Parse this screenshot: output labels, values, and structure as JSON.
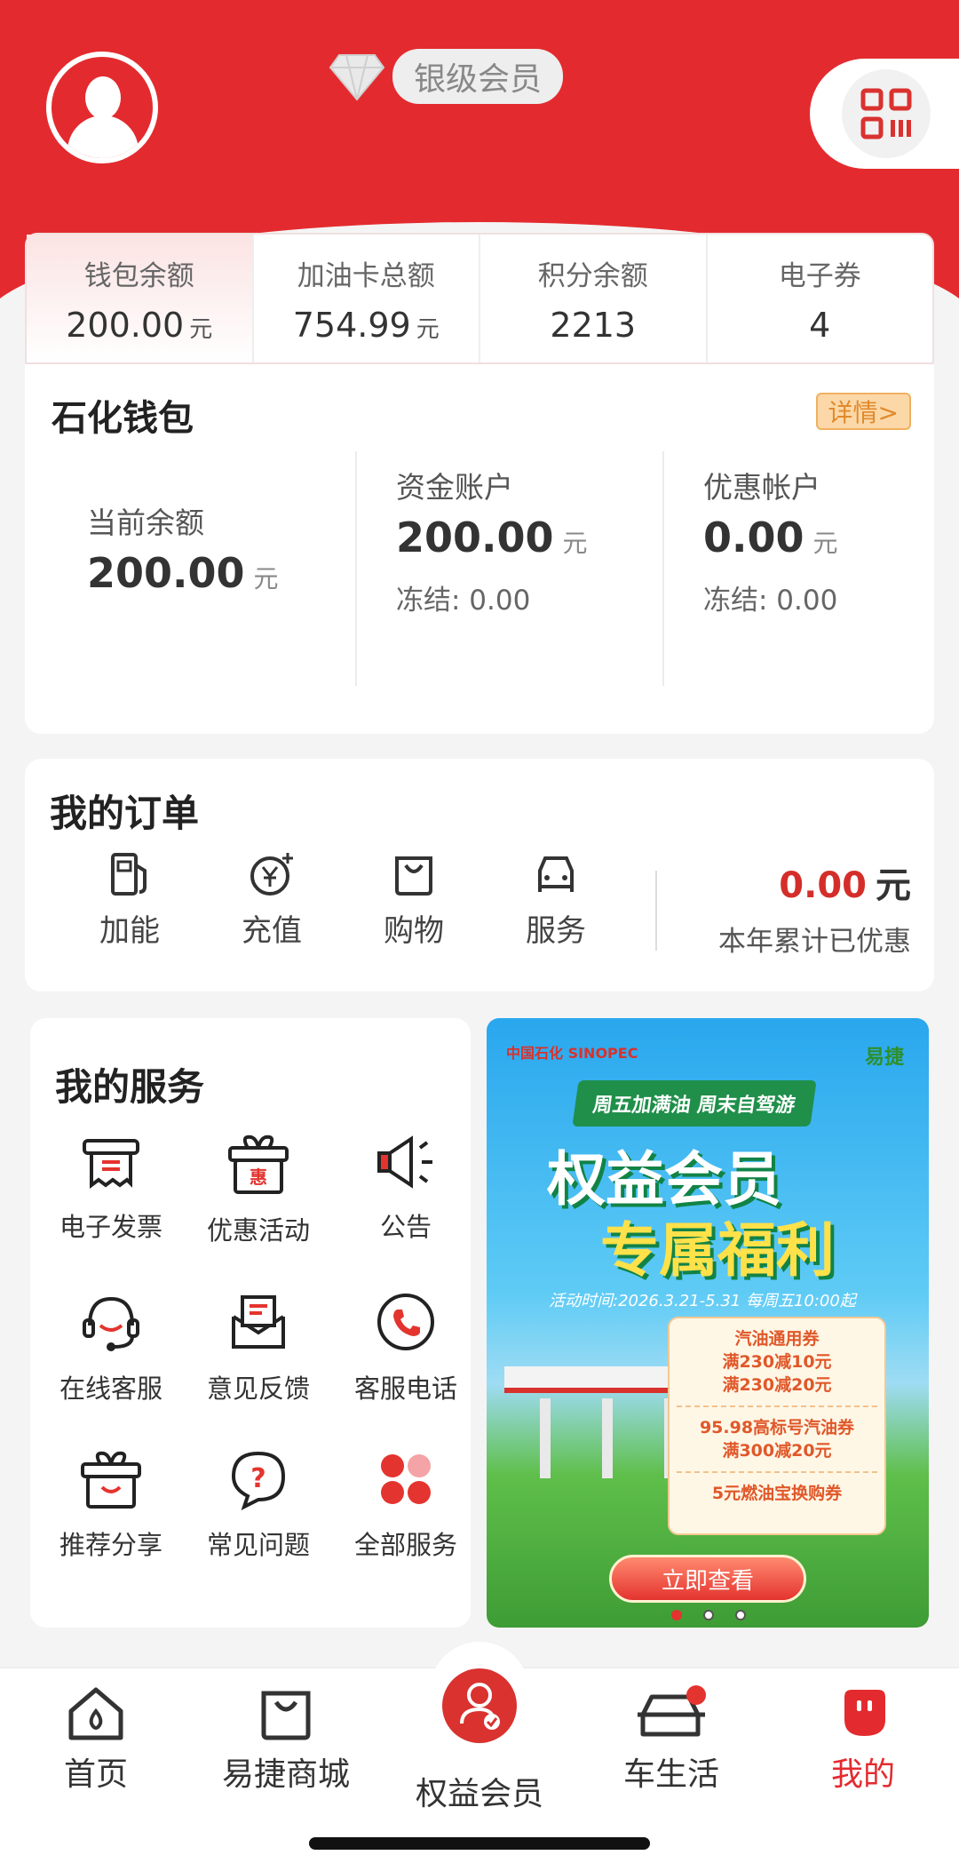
{
  "header": {
    "member_level": "银级会员"
  },
  "stats": [
    {
      "label": "钱包余额",
      "value": "200.00",
      "unit": "元"
    },
    {
      "label": "加油卡总额",
      "value": "754.99",
      "unit": "元"
    },
    {
      "label": "积分余额",
      "value": "2213",
      "unit": ""
    },
    {
      "label": "电子券",
      "value": "4",
      "unit": ""
    }
  ],
  "wallet": {
    "title": "石化钱包",
    "detail_label": "详情>",
    "current": {
      "label": "当前余额",
      "value": "200.00",
      "unit": "元"
    },
    "fund": {
      "label": "资金账户",
      "value": "200.00",
      "unit": "元",
      "frozen": "冻结: 0.00"
    },
    "promo": {
      "label": "优惠帐户",
      "value": "0.00",
      "unit": "元",
      "frozen": "冻结: 0.00"
    }
  },
  "orders": {
    "title": "我的订单",
    "items": [
      {
        "label": "加能",
        "icon": "fuel-pump-icon"
      },
      {
        "label": "充值",
        "icon": "yen-plus-icon"
      },
      {
        "label": "购物",
        "icon": "shopping-bag-icon"
      },
      {
        "label": "服务",
        "icon": "car-service-icon"
      }
    ],
    "saved_value": "0.00",
    "saved_unit": "元",
    "saved_label": "本年累计已优惠"
  },
  "services": {
    "title": "我的服务",
    "items": [
      {
        "label": "电子发票",
        "icon": "invoice-icon"
      },
      {
        "label": "优惠活动",
        "icon": "gift-box-icon"
      },
      {
        "label": "公告",
        "icon": "megaphone-icon"
      },
      {
        "label": "在线客服",
        "icon": "headset-icon"
      },
      {
        "label": "意见反馈",
        "icon": "envelope-icon"
      },
      {
        "label": "客服电话",
        "icon": "phone-icon"
      },
      {
        "label": "推荐分享",
        "icon": "share-gift-icon"
      },
      {
        "label": "常见问题",
        "icon": "question-icon"
      },
      {
        "label": "全部服务",
        "icon": "all-services-icon"
      }
    ]
  },
  "banner": {
    "logo_left": "中国石化 SINOPEC",
    "logo_right": "易捷",
    "ribbon": "周五加满油 周末自驾游",
    "headline1": "权益会员",
    "headline2": "专属福利",
    "activity_time": "活动时间:2026.3.21-5.31 每周五10:00起",
    "coupon_lines": [
      "汽油通用券",
      "满230减10元",
      "满230减20元",
      "95.98高标号汽油券",
      "满300减20元",
      "5元燃油宝换购券"
    ],
    "cta": "立即查看",
    "pages": 3,
    "active_page": 1
  },
  "tabbar": {
    "items": [
      {
        "label": "首页",
        "icon": "home-icon"
      },
      {
        "label": "易捷商城",
        "icon": "mall-bag-icon"
      },
      {
        "label": "权益会员",
        "icon": "member-icon"
      },
      {
        "label": "车生活",
        "icon": "car-icon"
      },
      {
        "label": "我的",
        "icon": "profile-icon"
      }
    ],
    "active": "我的"
  },
  "colors": {
    "brand_red": "#e32b2f",
    "accent_orange": "#e08a2c"
  }
}
